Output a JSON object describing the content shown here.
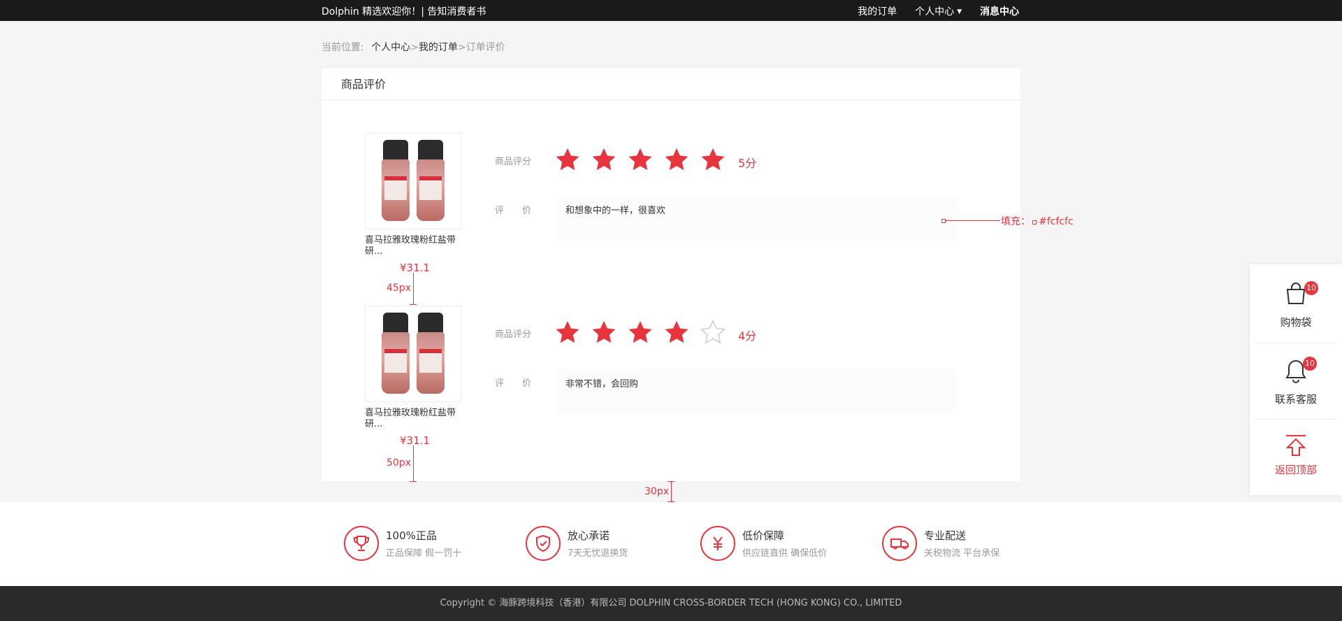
{
  "topbar": {
    "welcome": "Dolphin 精选欢迎你！| 告知消费者书",
    "nav": [
      "我的订单",
      "个人中心",
      "消息中心"
    ]
  },
  "breadcrumb": {
    "prefix": "当前位置:",
    "links": [
      "个人中心",
      "我的订单"
    ],
    "current": "订单评价",
    "sep": ">"
  },
  "panel": {
    "title": "商品评价",
    "rating_label": "商品评分",
    "review_label": "评　　价",
    "items": [
      {
        "name": "喜马拉雅玫瑰粉红盐带研...",
        "price": "¥31.1",
        "rating": 5,
        "score_text": "5分",
        "review": "和想象中的一样，很喜欢"
      },
      {
        "name": "喜马拉雅玫瑰粉红盐带研...",
        "price": "¥31.1",
        "rating": 4,
        "score_text": "4分",
        "review": "非常不错，会回购"
      }
    ]
  },
  "annotations": {
    "fill": "填充：",
    "fill_color": "#fcfcfc",
    "gap1": "45px",
    "gap2": "50px",
    "gap3": "30px"
  },
  "features": [
    {
      "icon": "trophy-icon",
      "title": "100%正品",
      "desc": "正品保障  假一罚十"
    },
    {
      "icon": "shield-check-icon",
      "title": "放心承诺",
      "desc": "7天无忧退换货"
    },
    {
      "icon": "yen-icon",
      "title": "低价保障",
      "desc": "供应链直供  确保低价"
    },
    {
      "icon": "truck-icon",
      "title": "专业配送",
      "desc": "关税物流 平台承保"
    }
  ],
  "footer": {
    "copyright": "Copyright ©  海豚跨境科技（香港）有限公司    DOLPHIN CROSS-BORDER TECH (HONG KONG) CO., LIMITED"
  },
  "sidebar": {
    "cart": {
      "label": "购物袋",
      "badge": "10"
    },
    "service": {
      "label": "联系客服",
      "badge": "10"
    },
    "top": {
      "label": "返回顶部"
    }
  },
  "colors": {
    "accent": "#e8343d",
    "star_empty": "#cccccc",
    "topbar": "#1a1a1a",
    "footer": "#2a2a2a"
  }
}
